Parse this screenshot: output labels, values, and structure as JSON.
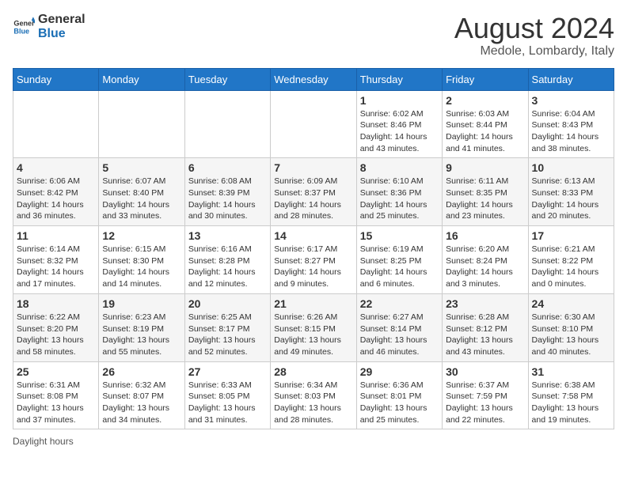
{
  "header": {
    "logo_general": "General",
    "logo_blue": "Blue",
    "title": "August 2024",
    "subtitle": "Medole, Lombardy, Italy"
  },
  "days_of_week": [
    "Sunday",
    "Monday",
    "Tuesday",
    "Wednesday",
    "Thursday",
    "Friday",
    "Saturday"
  ],
  "weeks": [
    [
      {
        "day": "",
        "info": ""
      },
      {
        "day": "",
        "info": ""
      },
      {
        "day": "",
        "info": ""
      },
      {
        "day": "",
        "info": ""
      },
      {
        "day": "1",
        "info": "Sunrise: 6:02 AM\nSunset: 8:46 PM\nDaylight: 14 hours and 43 minutes."
      },
      {
        "day": "2",
        "info": "Sunrise: 6:03 AM\nSunset: 8:44 PM\nDaylight: 14 hours and 41 minutes."
      },
      {
        "day": "3",
        "info": "Sunrise: 6:04 AM\nSunset: 8:43 PM\nDaylight: 14 hours and 38 minutes."
      }
    ],
    [
      {
        "day": "4",
        "info": "Sunrise: 6:06 AM\nSunset: 8:42 PM\nDaylight: 14 hours and 36 minutes."
      },
      {
        "day": "5",
        "info": "Sunrise: 6:07 AM\nSunset: 8:40 PM\nDaylight: 14 hours and 33 minutes."
      },
      {
        "day": "6",
        "info": "Sunrise: 6:08 AM\nSunset: 8:39 PM\nDaylight: 14 hours and 30 minutes."
      },
      {
        "day": "7",
        "info": "Sunrise: 6:09 AM\nSunset: 8:37 PM\nDaylight: 14 hours and 28 minutes."
      },
      {
        "day": "8",
        "info": "Sunrise: 6:10 AM\nSunset: 8:36 PM\nDaylight: 14 hours and 25 minutes."
      },
      {
        "day": "9",
        "info": "Sunrise: 6:11 AM\nSunset: 8:35 PM\nDaylight: 14 hours and 23 minutes."
      },
      {
        "day": "10",
        "info": "Sunrise: 6:13 AM\nSunset: 8:33 PM\nDaylight: 14 hours and 20 minutes."
      }
    ],
    [
      {
        "day": "11",
        "info": "Sunrise: 6:14 AM\nSunset: 8:32 PM\nDaylight: 14 hours and 17 minutes."
      },
      {
        "day": "12",
        "info": "Sunrise: 6:15 AM\nSunset: 8:30 PM\nDaylight: 14 hours and 14 minutes."
      },
      {
        "day": "13",
        "info": "Sunrise: 6:16 AM\nSunset: 8:28 PM\nDaylight: 14 hours and 12 minutes."
      },
      {
        "day": "14",
        "info": "Sunrise: 6:17 AM\nSunset: 8:27 PM\nDaylight: 14 hours and 9 minutes."
      },
      {
        "day": "15",
        "info": "Sunrise: 6:19 AM\nSunset: 8:25 PM\nDaylight: 14 hours and 6 minutes."
      },
      {
        "day": "16",
        "info": "Sunrise: 6:20 AM\nSunset: 8:24 PM\nDaylight: 14 hours and 3 minutes."
      },
      {
        "day": "17",
        "info": "Sunrise: 6:21 AM\nSunset: 8:22 PM\nDaylight: 14 hours and 0 minutes."
      }
    ],
    [
      {
        "day": "18",
        "info": "Sunrise: 6:22 AM\nSunset: 8:20 PM\nDaylight: 13 hours and 58 minutes."
      },
      {
        "day": "19",
        "info": "Sunrise: 6:23 AM\nSunset: 8:19 PM\nDaylight: 13 hours and 55 minutes."
      },
      {
        "day": "20",
        "info": "Sunrise: 6:25 AM\nSunset: 8:17 PM\nDaylight: 13 hours and 52 minutes."
      },
      {
        "day": "21",
        "info": "Sunrise: 6:26 AM\nSunset: 8:15 PM\nDaylight: 13 hours and 49 minutes."
      },
      {
        "day": "22",
        "info": "Sunrise: 6:27 AM\nSunset: 8:14 PM\nDaylight: 13 hours and 46 minutes."
      },
      {
        "day": "23",
        "info": "Sunrise: 6:28 AM\nSunset: 8:12 PM\nDaylight: 13 hours and 43 minutes."
      },
      {
        "day": "24",
        "info": "Sunrise: 6:30 AM\nSunset: 8:10 PM\nDaylight: 13 hours and 40 minutes."
      }
    ],
    [
      {
        "day": "25",
        "info": "Sunrise: 6:31 AM\nSunset: 8:08 PM\nDaylight: 13 hours and 37 minutes."
      },
      {
        "day": "26",
        "info": "Sunrise: 6:32 AM\nSunset: 8:07 PM\nDaylight: 13 hours and 34 minutes."
      },
      {
        "day": "27",
        "info": "Sunrise: 6:33 AM\nSunset: 8:05 PM\nDaylight: 13 hours and 31 minutes."
      },
      {
        "day": "28",
        "info": "Sunrise: 6:34 AM\nSunset: 8:03 PM\nDaylight: 13 hours and 28 minutes."
      },
      {
        "day": "29",
        "info": "Sunrise: 6:36 AM\nSunset: 8:01 PM\nDaylight: 13 hours and 25 minutes."
      },
      {
        "day": "30",
        "info": "Sunrise: 6:37 AM\nSunset: 7:59 PM\nDaylight: 13 hours and 22 minutes."
      },
      {
        "day": "31",
        "info": "Sunrise: 6:38 AM\nSunset: 7:58 PM\nDaylight: 13 hours and 19 minutes."
      }
    ]
  ],
  "footer": {
    "note": "Daylight hours"
  }
}
